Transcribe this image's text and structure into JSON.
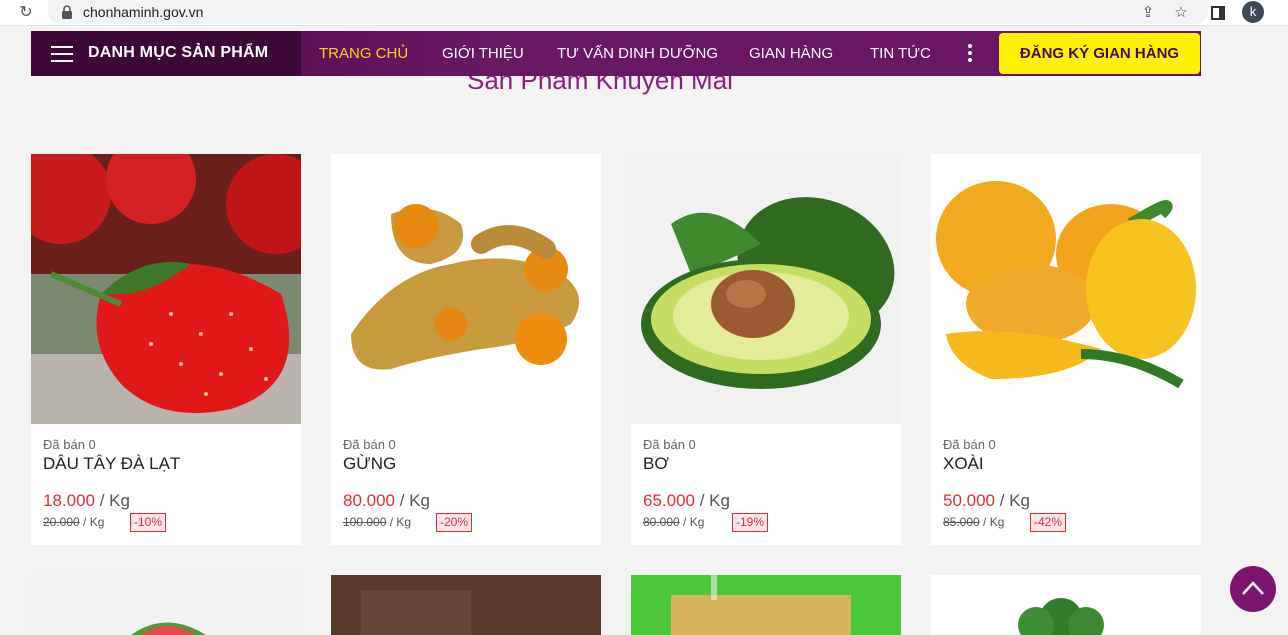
{
  "browser": {
    "url": "chonhaminh.gov.vn",
    "profile_initial": "k"
  },
  "nav": {
    "menu_title": "DANH MỤC SẢN PHẨM",
    "links": [
      "TRANG CHỦ",
      "GIỚI THIỆU",
      "TƯ VẤN DINH DƯỠNG",
      "GIAN HÀNG",
      "TIN TỨC"
    ],
    "active_link": "TRANG CHỦ",
    "register_label": "ĐĂNG KÝ GIAN HÀNG"
  },
  "section_title": "Sản Phẩm Khuyến Mãi",
  "products": [
    {
      "sold": "Đã bán 0",
      "name": "DÂU TÂY ĐÀ LẠT",
      "price": "18.000",
      "unit": " / Kg",
      "old_price": "20.000",
      "old_unit": " / Kg",
      "discount": "-10%",
      "image": "strawberry"
    },
    {
      "sold": "Đã bán 0",
      "name": "GỪNG",
      "price": "80.000",
      "unit": " / Kg",
      "old_price": "100.000",
      "old_unit": " / Kg",
      "discount": "-20%",
      "image": "turmeric"
    },
    {
      "sold": "Đã bán 0",
      "name": "BƠ",
      "price": "65.000",
      "unit": " / Kg",
      "old_price": "80.000",
      "old_unit": " / Kg",
      "discount": "-19%",
      "image": "avocado"
    },
    {
      "sold": "Đã bán 0",
      "name": "XOÀI",
      "price": "50.000",
      "unit": " / Kg",
      "old_price": "85.000",
      "old_unit": " / Kg",
      "discount": "-42%",
      "image": "mango"
    }
  ],
  "colors": {
    "nav_bg": "#6b1467",
    "accent_yellow": "#fff200",
    "price_red": "#e02d33",
    "title_purple": "#8a1f80"
  }
}
